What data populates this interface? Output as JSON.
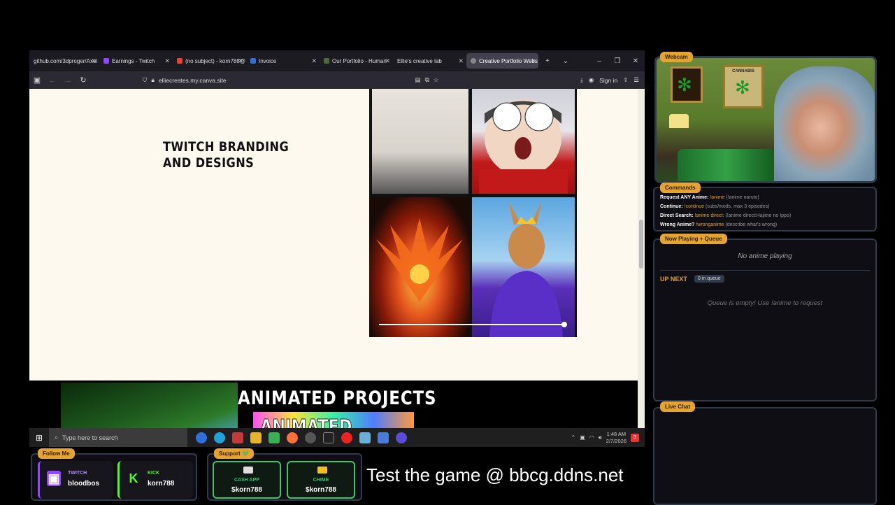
{
  "browser": {
    "tabs": [
      {
        "label": "github.com/3dproger/Axel",
        "color": "#666"
      },
      {
        "label": "Earnings - Twitch",
        "color": "#9146ff"
      },
      {
        "label": "(no subject) - korn788@",
        "color": "#ea4335"
      },
      {
        "label": "Invoice",
        "color": "#2f6fdb"
      },
      {
        "label": "Our Portfolio - Human",
        "color": "#4a6b3a"
      },
      {
        "label": "Ellie's creative lab",
        "color": "#444"
      },
      {
        "label": "Creative Portfolio Webs",
        "color": "#888"
      }
    ],
    "url": "elliecreates.my.canva.site",
    "sign_in": "Sign in",
    "heading_line1": "TWITCH BRANDING",
    "heading_line2": "AND DESIGNS",
    "animated_title": "ANIMATED PROJECTS",
    "emotes_title": "ANIMATED EMOTES"
  },
  "taskbar": {
    "search_placeholder": "Type here to search",
    "time": "1:48 AM",
    "date": "2/7/2026",
    "notifications": "3"
  },
  "overlay": {
    "webcam_label": "Webcam",
    "poster_text": "CANNABIS",
    "commands_label": "Commands",
    "commands": [
      {
        "name": "Request ANY Anime:",
        "cmd": "!anime",
        "hint": "(!anime naruto)"
      },
      {
        "name": "Continue:",
        "cmd": "!continue",
        "hint": "(subs/mods, max 3 episodes)"
      },
      {
        "name": "Direct Search:",
        "cmd": "!anime direct:",
        "hint": "(!anime direct:Hajime no Ippo)"
      },
      {
        "name": "Wrong Anime?",
        "cmd": "!wronganime",
        "hint": "(describe what's wrong)"
      }
    ],
    "now_playing_label": "Now Playing + Queue",
    "now_playing_text": "No anime playing",
    "up_next": "UP NEXT",
    "queue_count": "0 in queue",
    "queue_empty": "Queue is empty! Use !anime to request",
    "live_chat_label": "Live Chat",
    "follow_label": "Follow Me",
    "twitch_name": "TWITCH",
    "twitch_handle": "bloodbos",
    "kick_name": "KICK",
    "kick_handle": "korn788",
    "support_label": "Support 💚",
    "cashapp_name": "CASH APP",
    "cashapp_handle": "$korn788",
    "chime_name": "CHIME",
    "chime_handle": "$korn788",
    "game_banner": "Test the game @ bbcg.ddns.net"
  },
  "colors": {
    "accent": "#e3a431",
    "twitch": "#9146ff",
    "kick": "#53fc18",
    "cashapp": "#3ec46d"
  }
}
